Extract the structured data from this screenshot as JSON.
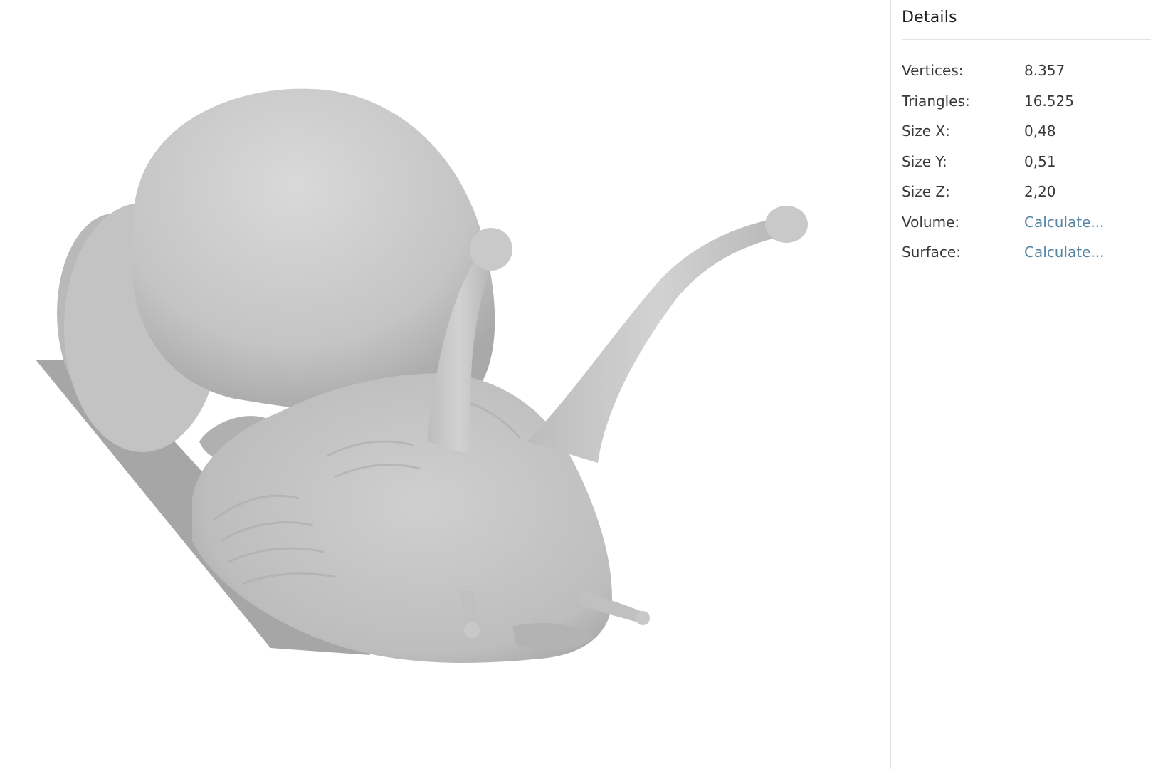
{
  "panel": {
    "title": "Details",
    "rows": [
      {
        "label": "Vertices:",
        "value": "8.357"
      },
      {
        "label": "Triangles:",
        "value": "16.525"
      },
      {
        "label": "Size X:",
        "value": "0,48"
      },
      {
        "label": "Size Y:",
        "value": "0,51"
      },
      {
        "label": "Size Z:",
        "value": "2,20"
      },
      {
        "label": "Volume:",
        "value": "Calculate..."
      },
      {
        "label": "Surface:",
        "value": "Calculate..."
      }
    ]
  },
  "colors": {
    "background": "#ffffff",
    "model_gray": "#c8c8c8",
    "link": "#5a86a6",
    "text": "#3a3a3a"
  }
}
